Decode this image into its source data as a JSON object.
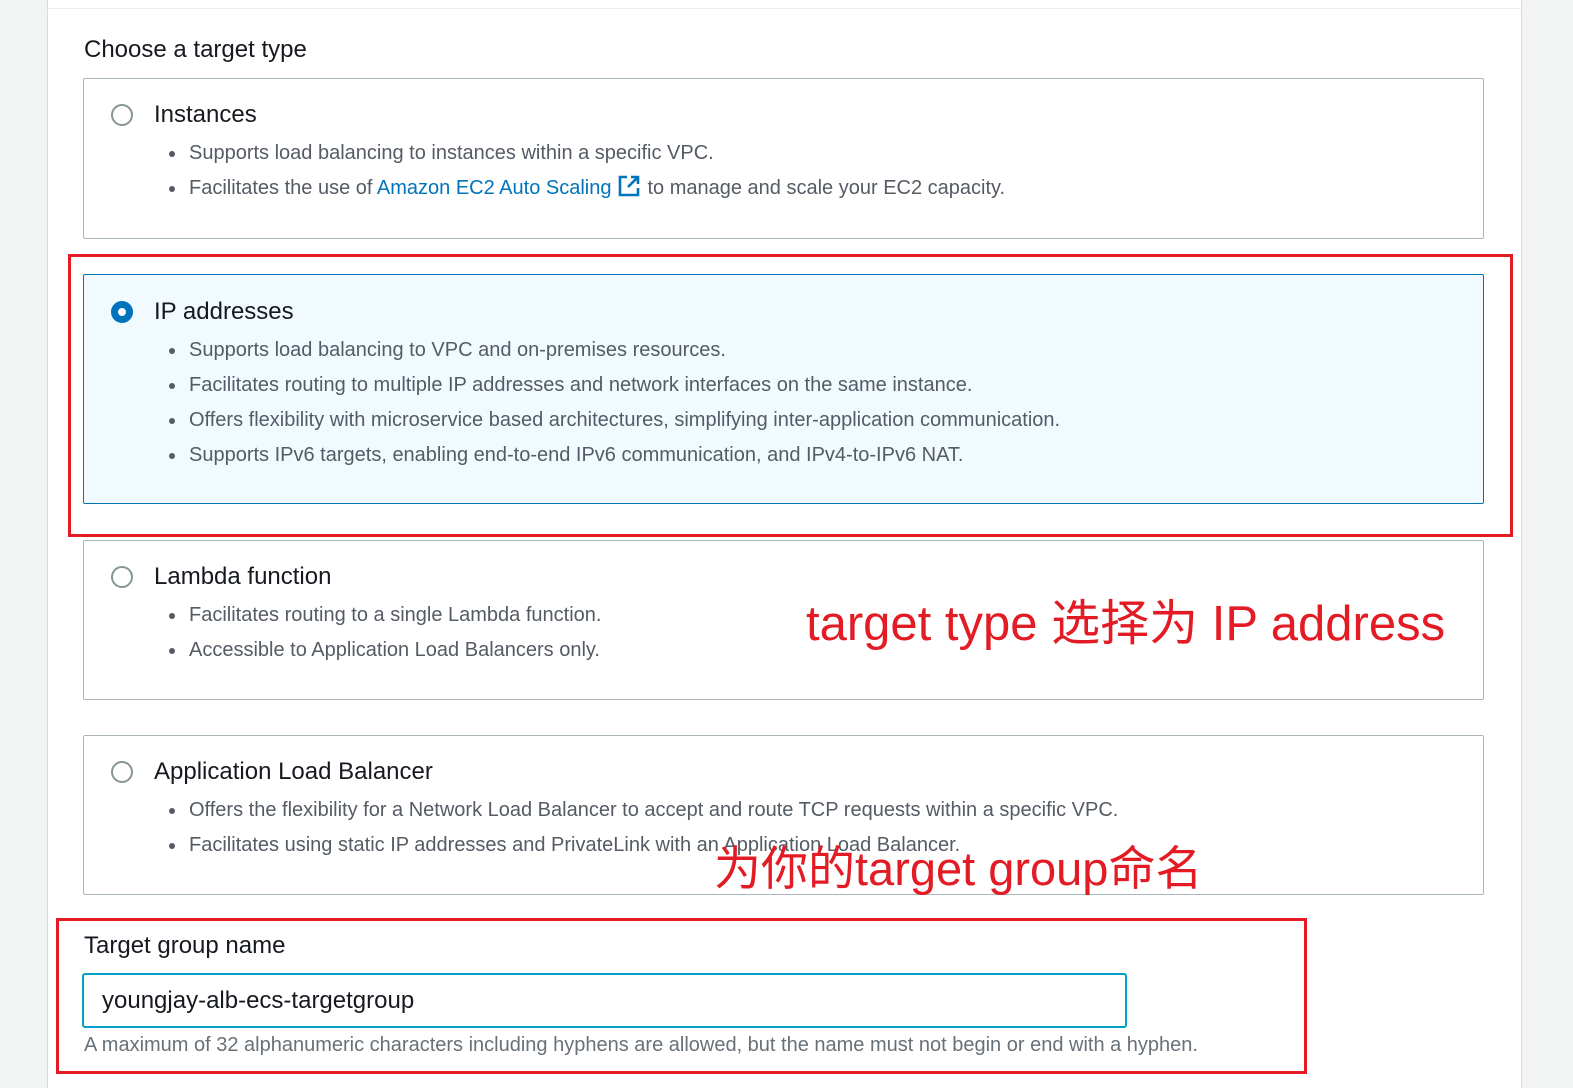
{
  "section_title": "Choose a target type",
  "options": [
    {
      "label": "Instances",
      "selected": false,
      "bullets": [
        "Supports load balancing to instances within a specific VPC.",
        "Facilitates the use of",
        "to manage and scale your EC2 capacity."
      ],
      "link_text": "Amazon EC2 Auto Scaling"
    },
    {
      "label": "IP addresses",
      "selected": true,
      "bullets": [
        "Supports load balancing to VPC and on-premises resources.",
        "Facilitates routing to multiple IP addresses and network interfaces on the same instance.",
        "Offers flexibility with microservice based architectures, simplifying inter-application communication.",
        "Supports IPv6 targets, enabling end-to-end IPv6 communication, and IPv4-to-IPv6 NAT."
      ]
    },
    {
      "label": "Lambda function",
      "selected": false,
      "bullets": [
        "Facilitates routing to a single Lambda function.",
        "Accessible to Application Load Balancers only."
      ]
    },
    {
      "label": "Application Load Balancer",
      "selected": false,
      "bullets": [
        "Offers the flexibility for a Network Load Balancer to accept and route TCP requests within a specific VPC.",
        "Facilitates using static IP addresses and PrivateLink with an Application Load Balancer."
      ]
    }
  ],
  "target_group": {
    "label": "Target group name",
    "value": "youngjay-alb-ecs-targetgroup",
    "hint": "A maximum of 32 alphanumeric characters including hyphens are allowed, but the name must not begin or end with a hyphen."
  },
  "annotations": {
    "target_type": "target type 选择为 IP address",
    "name_group": "为你的target group命名"
  },
  "colors": {
    "accent": "#0073bb",
    "annotation_red": "#e21b24",
    "input_focus": "#00a1c9"
  },
  "icons": {
    "external_link": "external-link-icon"
  }
}
